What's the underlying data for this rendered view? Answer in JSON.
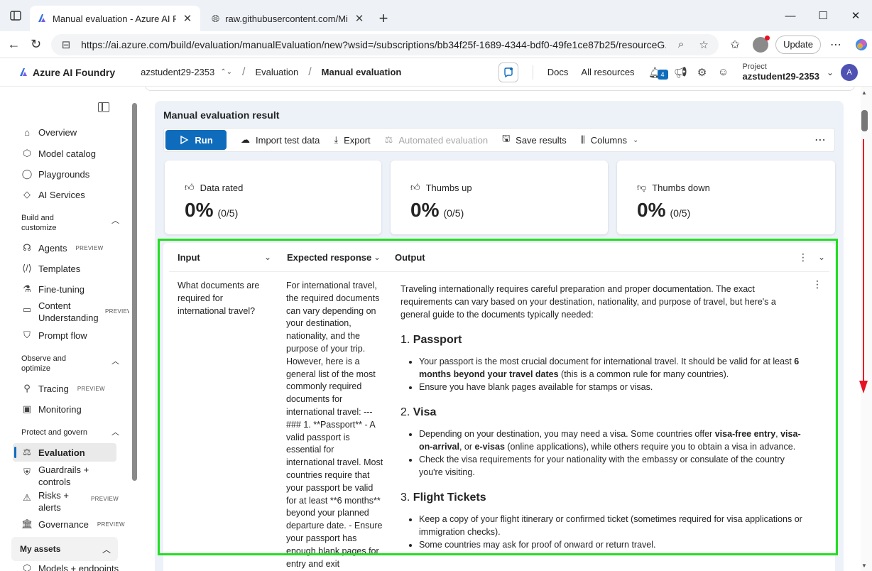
{
  "browser": {
    "tabs": [
      {
        "title": "Manual evaluation - Azure AI Fou",
        "active": true
      },
      {
        "title": "raw.githubusercontent.com/Micro",
        "active": false
      }
    ],
    "url": "https://ai.azure.com/build/evaluation/manualEvaluation/new?wsid=/subscriptions/bb34f25f-1689-4344-bdf0-49fe1ce87b25/resourceG...",
    "update_label": "Update"
  },
  "header": {
    "brand": "Azure AI Foundry",
    "hub": "azstudent29-2353",
    "breadcrumb": [
      "Evaluation",
      "Manual evaluation"
    ],
    "links": [
      "Docs",
      "All resources"
    ],
    "notif_count": "4",
    "project_label": "Project",
    "project_value": "azstudent29-2353",
    "user_initial": "A",
    "accent": "#0f6cbd"
  },
  "sidebar": {
    "items_top": [
      "Overview",
      "Model catalog",
      "Playgrounds",
      "AI Services"
    ],
    "group_build": "Build and customize",
    "items_build": [
      "Agents",
      "Templates",
      "Fine-tuning",
      "Content Understanding",
      "Prompt flow"
    ],
    "group_observe": "Observe and optimize",
    "items_observe": [
      "Tracing",
      "Monitoring"
    ],
    "group_protect": "Protect and govern",
    "items_protect": [
      "Evaluation",
      "Guardrails + controls",
      "Risks + alerts",
      "Governance"
    ],
    "preview": "PREVIEW",
    "my_assets": "My assets",
    "models_endpoints": "Models + endpoints"
  },
  "result": {
    "title": "Manual evaluation result",
    "toolbar": {
      "run": "Run",
      "import": "Import test data",
      "export": "Export",
      "automated": "Automated evaluation",
      "save": "Save results",
      "columns": "Columns"
    },
    "stats": [
      {
        "label": "Data rated",
        "value": "0%",
        "detail": "(0/5)"
      },
      {
        "label": "Thumbs up",
        "value": "0%",
        "detail": "(0/5)"
      },
      {
        "label": "Thumbs down",
        "value": "0%",
        "detail": "(0/5)"
      }
    ],
    "columns": [
      "Input",
      "Expected response",
      "Output"
    ],
    "row": {
      "input": "What documents are required for international travel?",
      "expected": "For international travel, the required documents can vary depending on your destination, nationality, and the purpose of your trip. However, here is a general list of the most commonly required documents for international travel: --- ### 1. **Passport** - A valid passport is essential for international travel. Most countries require that your passport be valid for at least **6 months** beyond your planned departure date. - Ensure your passport has enough blank pages for entry and exit",
      "output": {
        "intro": "Traveling internationally requires careful preparation and proper documentation. The exact requirements can vary based on your destination, nationality, and purpose of travel, but here's a general guide to the documents typically needed:",
        "s1_num": "1.",
        "s1_title": "Passport",
        "s1_b1_a": "Your passport is the most crucial document for international travel. It should be valid for at least ",
        "s1_b1_bold": "6 months beyond your travel dates",
        "s1_b1_b": " (this is a common rule for many countries).",
        "s1_b2": "Ensure you have blank pages available for stamps or visas.",
        "s2_num": "2.",
        "s2_title": "Visa",
        "s2_b1_a": "Depending on your destination, you may need a visa. Some countries offer ",
        "s2_b1_bold1": "visa-free entry",
        "s2_b1_b": ", ",
        "s2_b1_bold2": "visa-on-arrival",
        "s2_b1_c": ", or ",
        "s2_b1_bold3": "e-visas",
        "s2_b1_d": " (online applications), while others require you to obtain a visa in advance.",
        "s2_b2": "Check the visa requirements for your nationality with the embassy or consulate of the country you're visiting.",
        "s3_num": "3.",
        "s3_title": "Flight Tickets",
        "s3_b1": "Keep a copy of your flight itinerary or confirmed ticket (sometimes required for visa applications or immigration checks).",
        "s3_b2": "Some countries may ask for proof of onward or return travel."
      }
    }
  },
  "highlight_color": "#22dd22",
  "arrow_color": "#e81123"
}
